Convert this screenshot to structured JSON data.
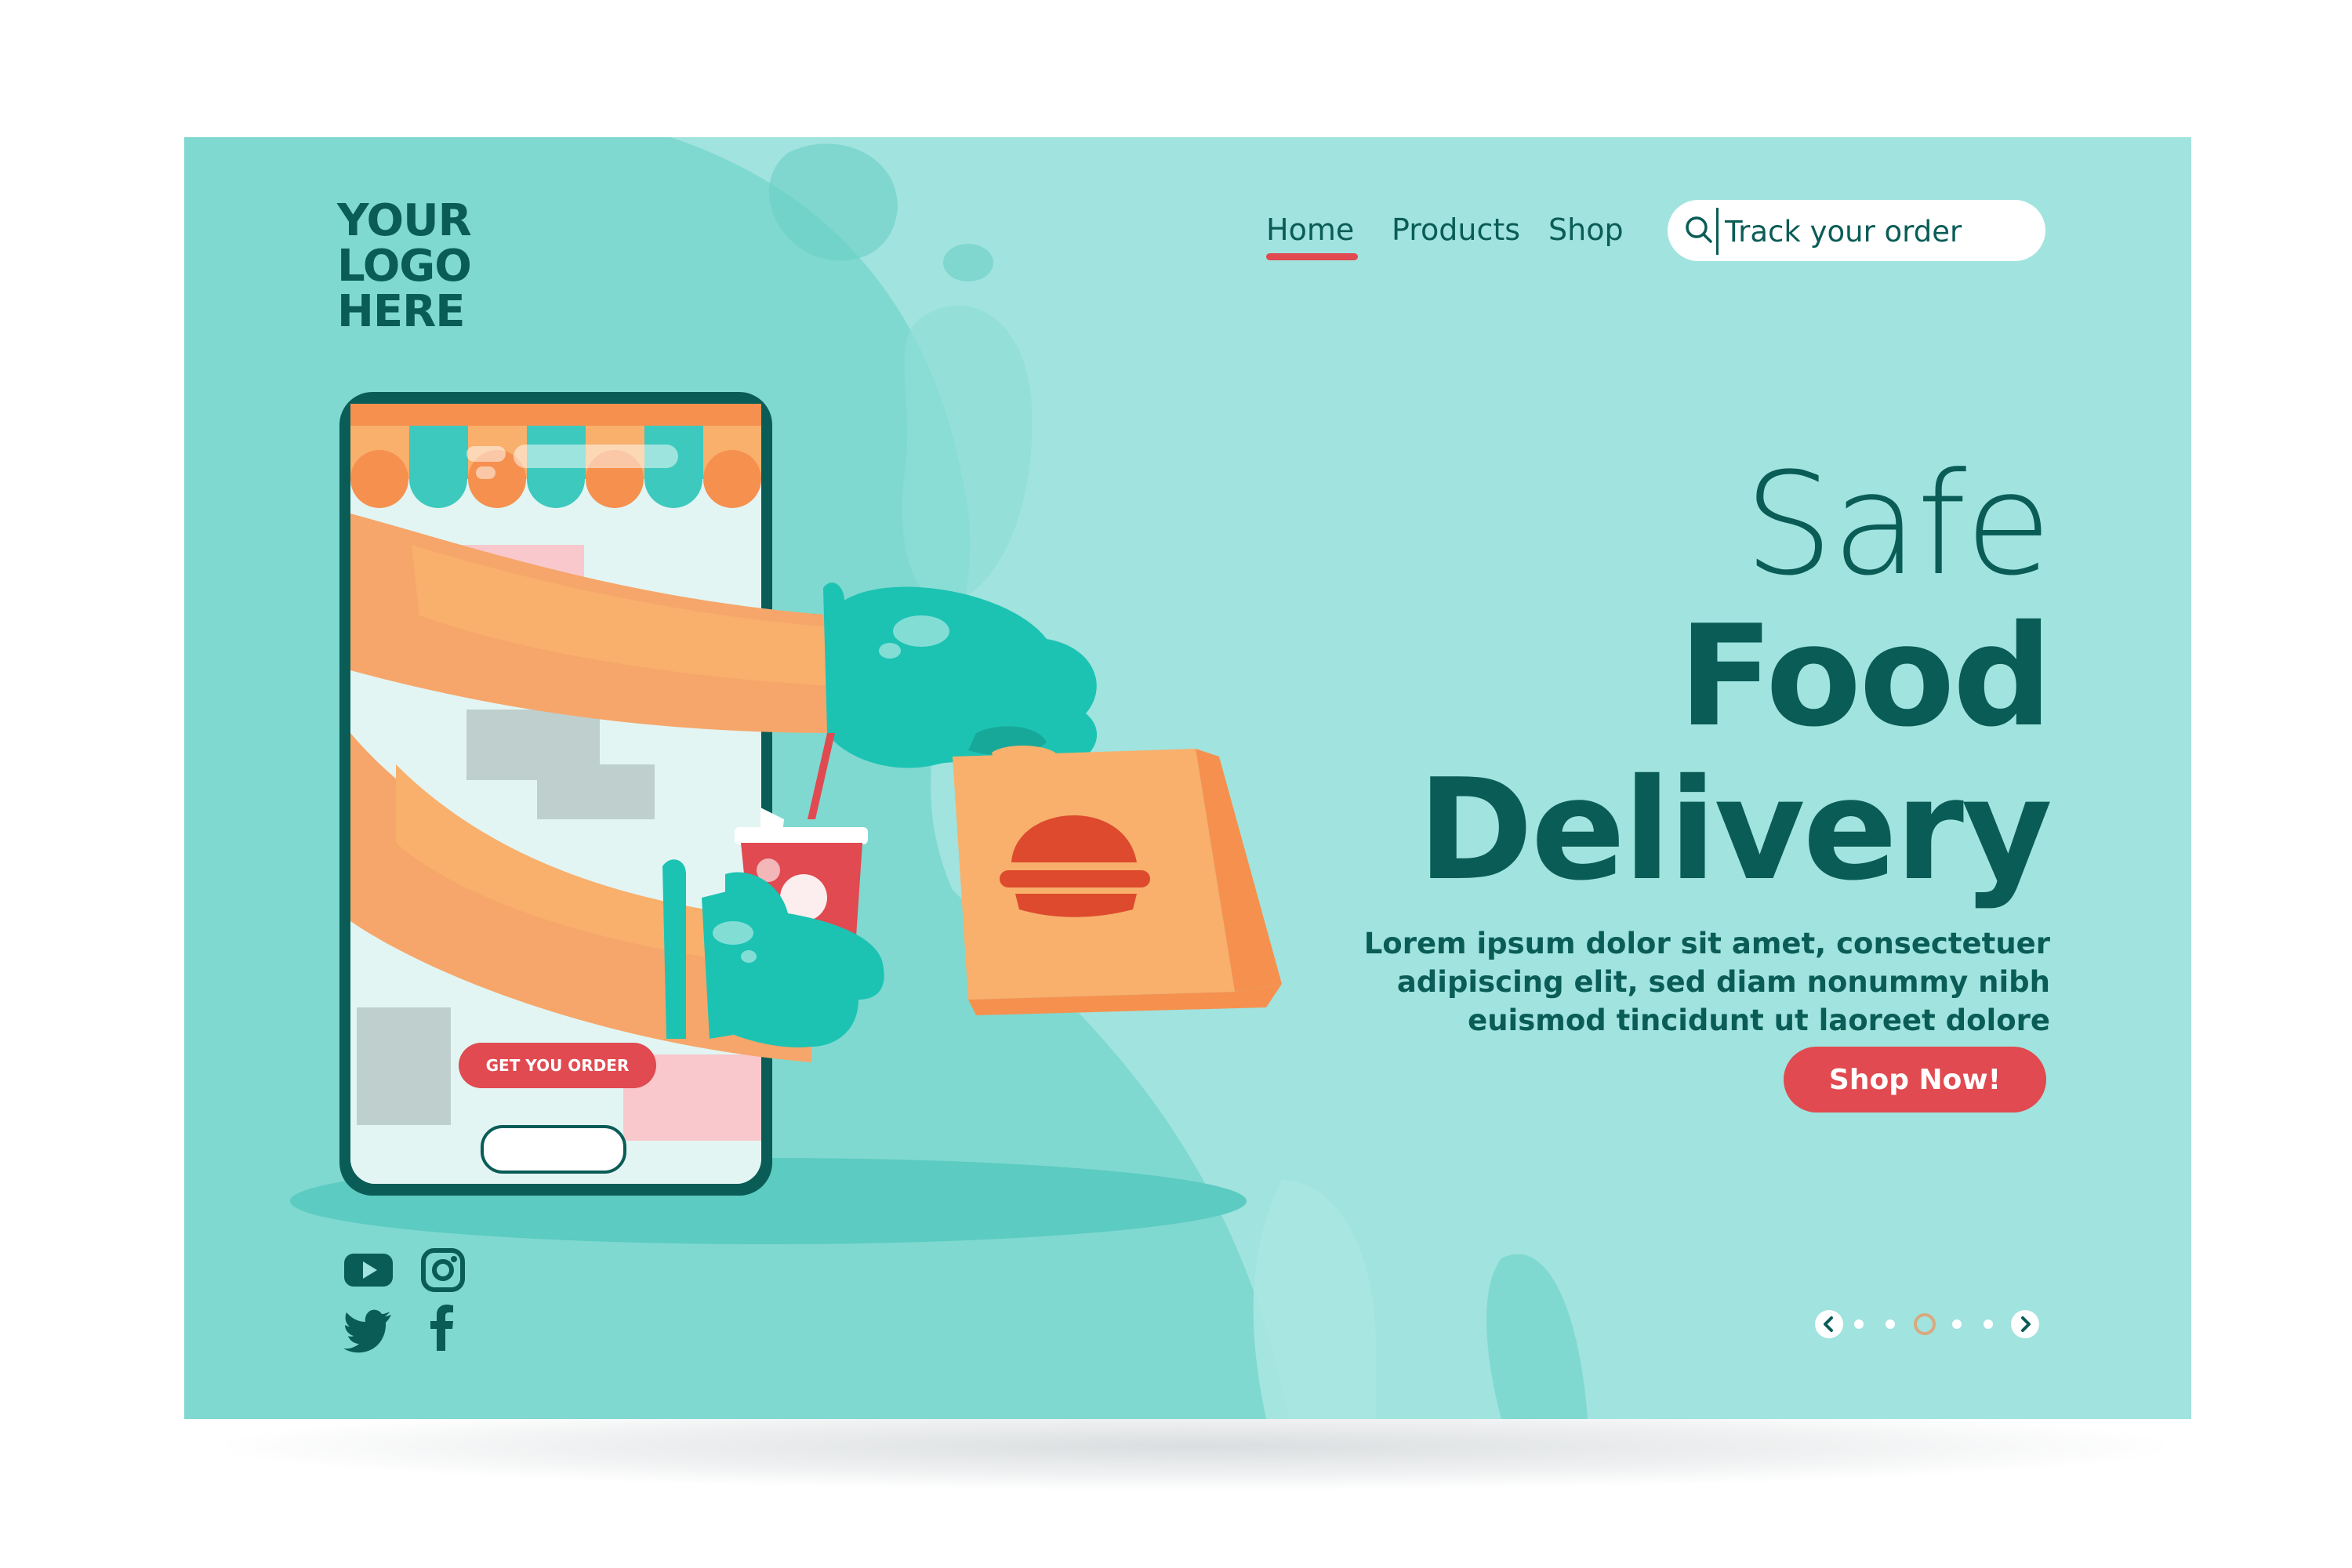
{
  "logo": {
    "line1": "YOUR",
    "line2": "LOGO",
    "line3": "HERE"
  },
  "nav": {
    "items": [
      {
        "label": "Home",
        "active": true
      },
      {
        "label": "Products",
        "active": false
      },
      {
        "label": "Shop",
        "active": false
      }
    ]
  },
  "search": {
    "placeholder": "Track your order",
    "icon": "search-icon"
  },
  "hero": {
    "title_line1": "Safe",
    "title_line2": "Food",
    "title_line3": "Delivery",
    "description": "Lorem ipsum dolor sit amet, consectetuer adipiscing elit, sed diam nonummy nibh euismod tincidunt ut laoreet dolore",
    "cta_label": "Shop Now!"
  },
  "phone": {
    "button_label": "GET YOU ORDER"
  },
  "socials": [
    "youtube-icon",
    "instagram-icon",
    "twitter-icon",
    "facebook-icon"
  ],
  "carousel": {
    "slide_count": 5,
    "active_index": 3
  },
  "colors": {
    "background": "#a1e3de",
    "blob_light": "#7fd9d0",
    "text_dark": "#0a5c57",
    "accent_red": "#e04a50",
    "glove": "#1cc3b3",
    "skin": "#f6a66a",
    "bag": "#f8b06c"
  }
}
